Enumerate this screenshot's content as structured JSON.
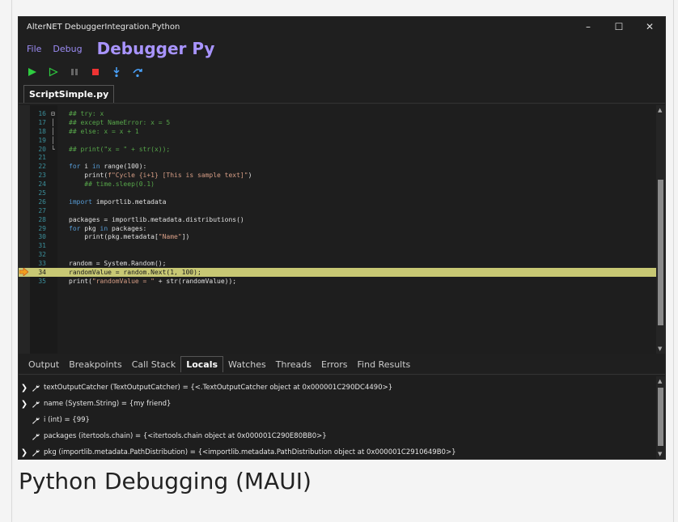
{
  "window": {
    "title": "AlterNET DebuggerIntegration.Python",
    "controls": [
      "–",
      "☐",
      "✕"
    ]
  },
  "menu": {
    "items": [
      "File",
      "Debug"
    ],
    "app_title": "Debugger Py"
  },
  "toolbar": {
    "buttons": [
      "run",
      "run-without-debug",
      "pause",
      "stop",
      "step-into",
      "step-over"
    ]
  },
  "editor": {
    "tab": "ScriptSimple.py",
    "current_line": 34,
    "lines": [
      {
        "n": "16",
        "code": "## try: x"
      },
      {
        "n": "17",
        "code": "## except NameError: x = 5"
      },
      {
        "n": "18",
        "code": "## else: x = x + 1"
      },
      {
        "n": "19",
        "code": ""
      },
      {
        "n": "20",
        "code": "## print(\"x = \" + str(x));"
      },
      {
        "n": "21",
        "code": ""
      },
      {
        "n": "22",
        "code": "for i in range(100):"
      },
      {
        "n": "23",
        "code": "    print(f\"Cycle {i+1} [This is sample text]\")"
      },
      {
        "n": "24",
        "code": "    ## time.sleep(0.1)"
      },
      {
        "n": "25",
        "code": ""
      },
      {
        "n": "26",
        "code": "import importlib.metadata"
      },
      {
        "n": "27",
        "code": ""
      },
      {
        "n": "28",
        "code": "packages = importlib.metadata.distributions()"
      },
      {
        "n": "29",
        "code": "for pkg in packages:"
      },
      {
        "n": "30",
        "code": "    print(pkg.metadata[\"Name\"])"
      },
      {
        "n": "31",
        "code": ""
      },
      {
        "n": "32",
        "code": ""
      },
      {
        "n": "33",
        "code": "random = System.Random();"
      },
      {
        "n": "34",
        "code": "randomValue = random.Next(1, 100);"
      },
      {
        "n": "35",
        "code": "print(\"randomValue = \" + str(randomValue));"
      }
    ]
  },
  "bottom_tabs": [
    "Output",
    "Breakpoints",
    "Call Stack",
    "Locals",
    "Watches",
    "Threads",
    "Errors",
    "Find Results"
  ],
  "active_bottom_tab": "Locals",
  "locals": [
    {
      "expandable": true,
      "text": "textOutputCatcher (TextOutputCatcher) = {<.TextOutputCatcher object at 0x000001C290DC4490>}"
    },
    {
      "expandable": true,
      "text": "name (System.String) = {my friend}"
    },
    {
      "expandable": false,
      "text": "i (int) = {99}"
    },
    {
      "expandable": false,
      "text": "packages (itertools.chain) = {<itertools.chain object at 0x000001C290E80BB0>}"
    },
    {
      "expandable": true,
      "text": "pkg (importlib.metadata.PathDistribution) = {<importlib.metadata.PathDistribution object at 0x000001C2910649B0>}"
    }
  ],
  "caption": "Python Debugging (MAUI)",
  "colors": {
    "accent": "#a894ff",
    "current_line": "#c8c874",
    "run_green": "#2ecc40",
    "stop_red": "#e33",
    "step_blue": "#4aa3ff"
  }
}
